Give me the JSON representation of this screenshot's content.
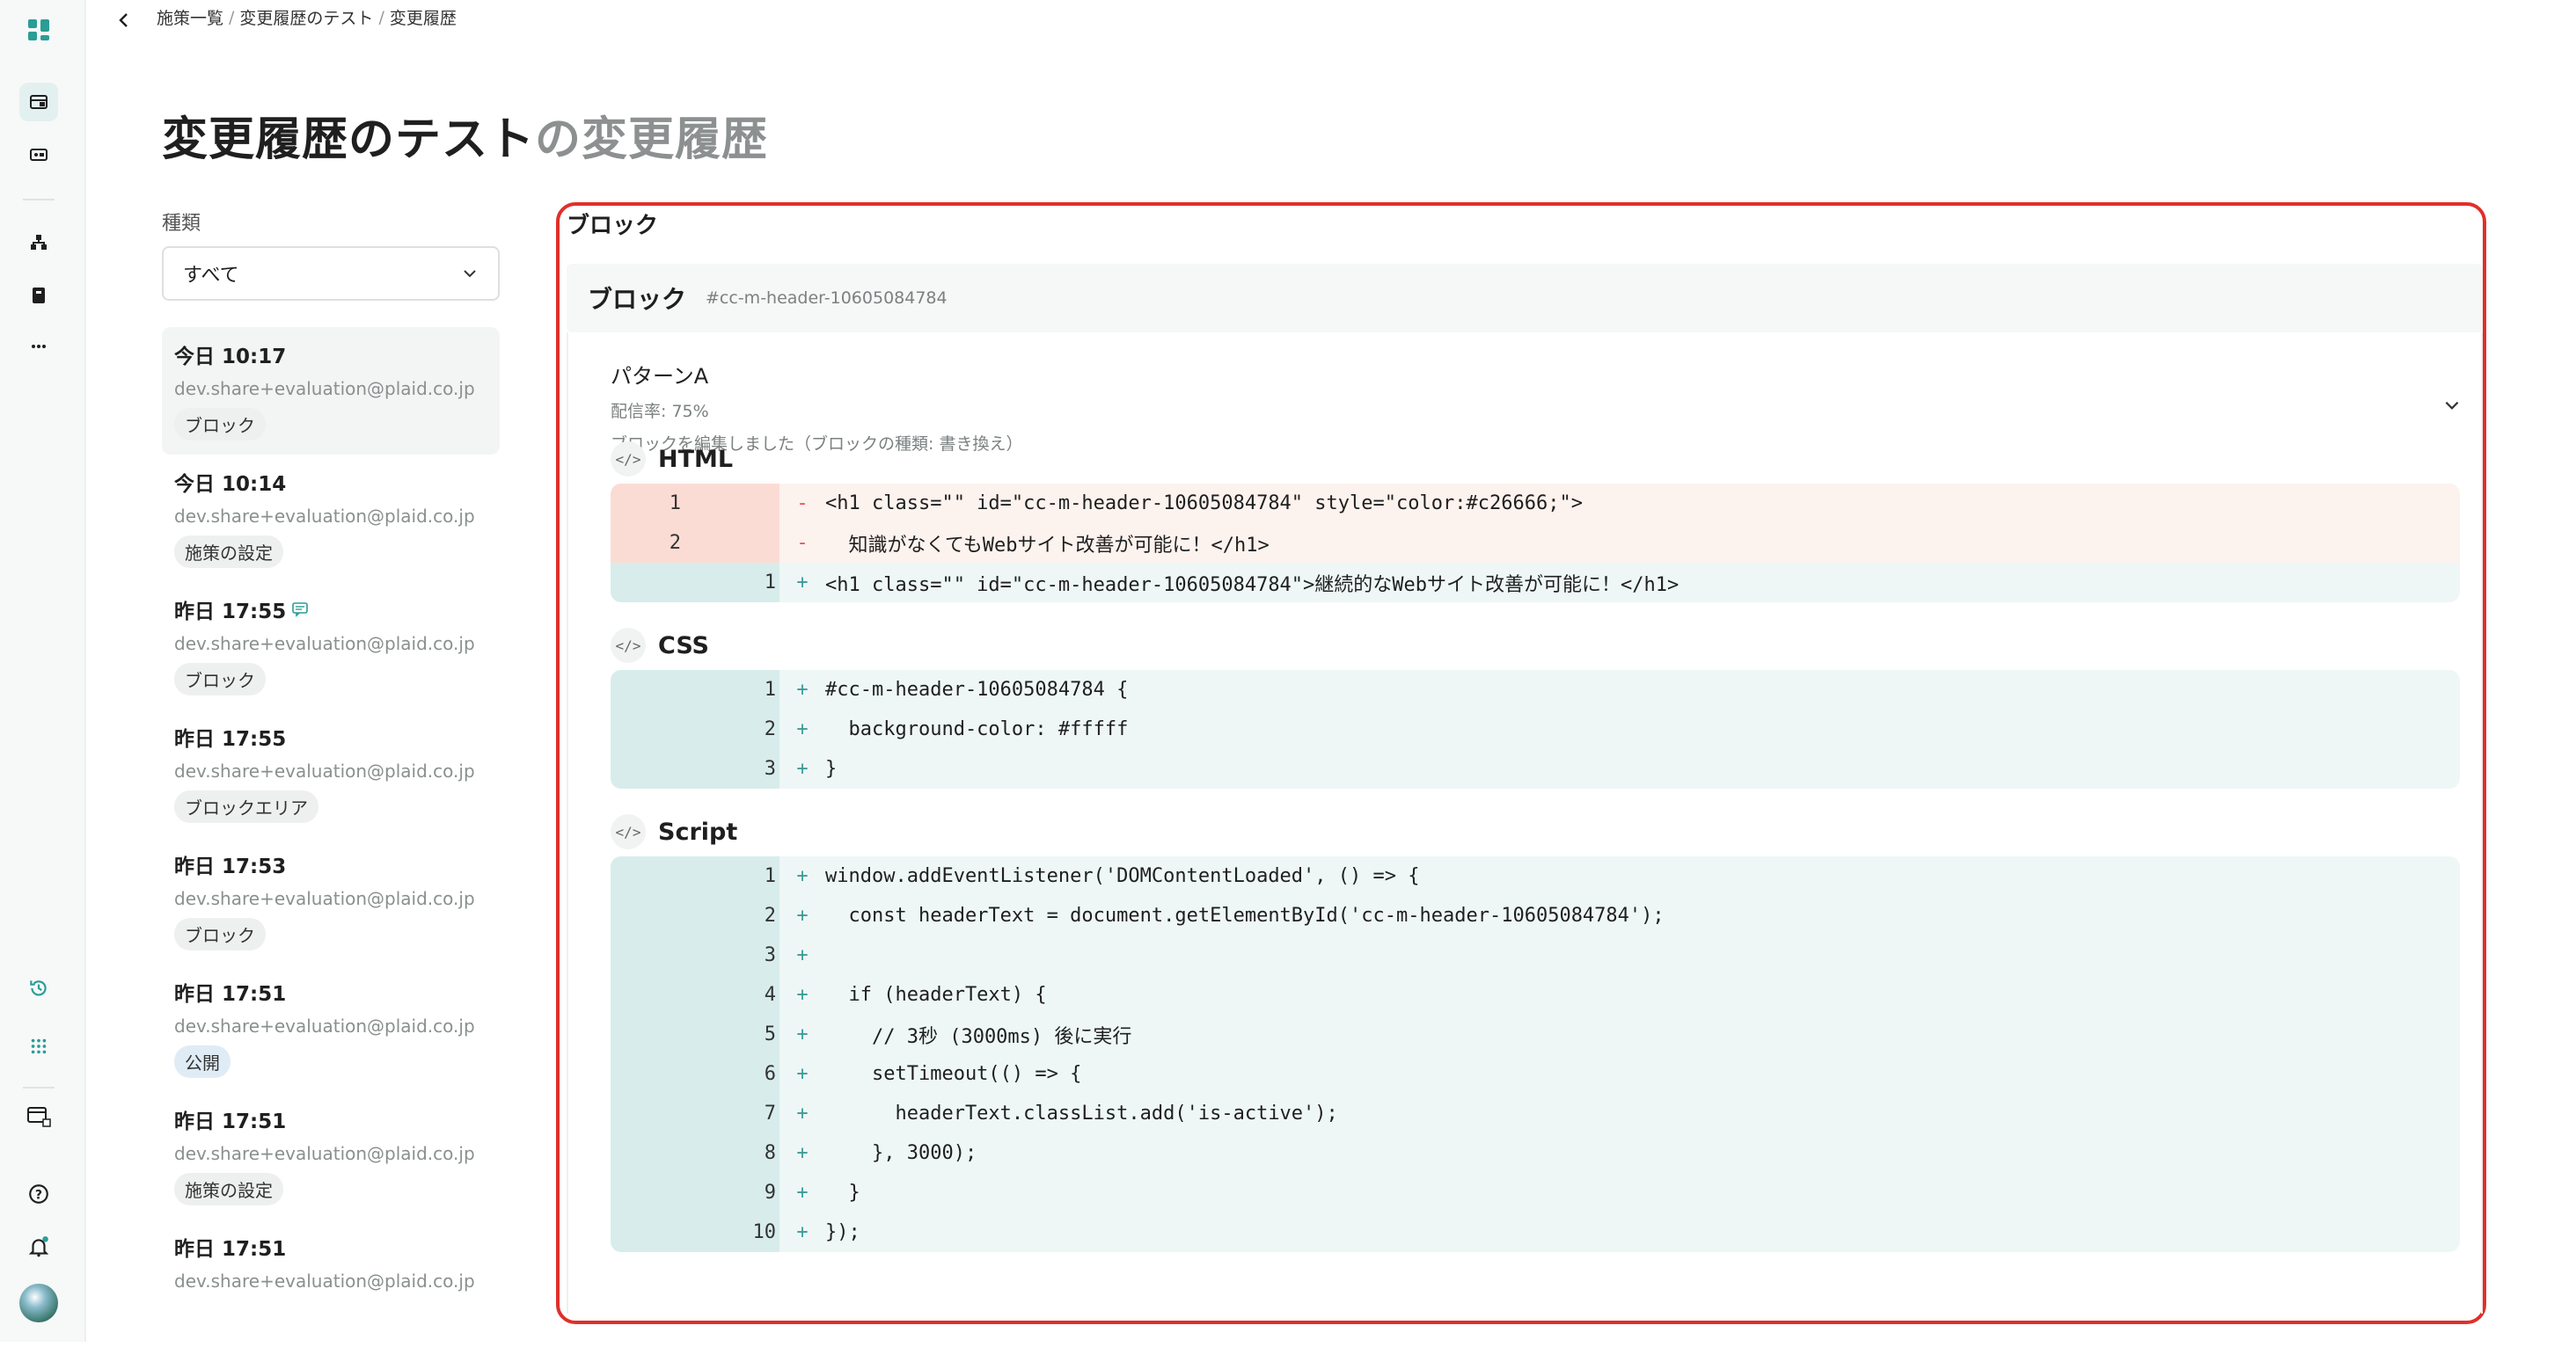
{
  "breadcrumb": [
    "施策一覧",
    "変更履歴のテスト",
    "変更履歴"
  ],
  "title": {
    "main": "変更履歴のテスト",
    "suffix": "の変更履歴"
  },
  "filter": {
    "label": "種類",
    "value": "すべて"
  },
  "history": [
    {
      "time": "今日 10:17",
      "email": "dev.share+evaluation@plaid.co.jp",
      "badge": "ブロック",
      "selected": true
    },
    {
      "time": "今日 10:14",
      "email": "dev.share+evaluation@plaid.co.jp",
      "badge": "施策の設定"
    },
    {
      "time": "昨日 17:55",
      "email": "dev.share+evaluation@plaid.co.jp",
      "badge": "ブロック",
      "comment": true
    },
    {
      "time": "昨日 17:55",
      "email": "dev.share+evaluation@plaid.co.jp",
      "badge": "ブロックエリア"
    },
    {
      "time": "昨日 17:53",
      "email": "dev.share+evaluation@plaid.co.jp",
      "badge": "ブロック"
    },
    {
      "time": "昨日 17:51",
      "email": "dev.share+evaluation@plaid.co.jp",
      "badge": "公開"
    },
    {
      "time": "昨日 17:51",
      "email": "dev.share+evaluation@plaid.co.jp",
      "badge": "施策の設定"
    },
    {
      "time": "昨日 17:51",
      "email": "dev.share+evaluation@plaid.co.jp",
      "badge": ""
    }
  ],
  "panel": {
    "title": "ブロック",
    "block_title": "ブロック",
    "block_id": "#cc-m-header-10605084784",
    "pattern_name": "パターンA",
    "pattern_rate": "配信率: 75%",
    "pattern_desc": "ブロックを編集しました（ブロックの種類: 書き換え）"
  },
  "sections": [
    {
      "name": "HTML",
      "lines": [
        {
          "old": "1",
          "new": "",
          "sign": "-",
          "type": "del",
          "text": "<h1 class=\"\" id=\"cc-m-header-10605084784\" style=\"color:#c26666;\">"
        },
        {
          "old": "2",
          "new": "",
          "sign": "-",
          "type": "del",
          "text": "  知識がなくてもWebサイト改善が可能に！</h1>"
        },
        {
          "old": "",
          "new": "1",
          "sign": "+",
          "type": "add",
          "text": "<h1 class=\"\" id=\"cc-m-header-10605084784\">継続的なWebサイト改善が可能に！</h1>"
        }
      ]
    },
    {
      "name": "CSS",
      "lines": [
        {
          "old": "",
          "new": "1",
          "sign": "+",
          "type": "add",
          "text": "#cc-m-header-10605084784 {"
        },
        {
          "old": "",
          "new": "2",
          "sign": "+",
          "type": "add",
          "text": "  background-color: #fffff"
        },
        {
          "old": "",
          "new": "3",
          "sign": "+",
          "type": "add",
          "text": "}"
        }
      ]
    },
    {
      "name": "Script",
      "lines": [
        {
          "old": "",
          "new": "1",
          "sign": "+",
          "type": "add",
          "text": "window.addEventListener('DOMContentLoaded', () => {"
        },
        {
          "old": "",
          "new": "2",
          "sign": "+",
          "type": "add",
          "text": "  const headerText = document.getElementById('cc-m-header-10605084784');"
        },
        {
          "old": "",
          "new": "3",
          "sign": "+",
          "type": "add",
          "text": ""
        },
        {
          "old": "",
          "new": "4",
          "sign": "+",
          "type": "add",
          "text": "  if (headerText) {"
        },
        {
          "old": "",
          "new": "5",
          "sign": "+",
          "type": "add",
          "text": "    // 3秒 (3000ms) 後に実行"
        },
        {
          "old": "",
          "new": "6",
          "sign": "+",
          "type": "add",
          "text": "    setTimeout(() => {"
        },
        {
          "old": "",
          "new": "7",
          "sign": "+",
          "type": "add",
          "text": "      headerText.classList.add('is-active');"
        },
        {
          "old": "",
          "new": "8",
          "sign": "+",
          "type": "add",
          "text": "    }, 3000);"
        },
        {
          "old": "",
          "new": "9",
          "sign": "+",
          "type": "add",
          "text": "  }"
        },
        {
          "old": "",
          "new": "10",
          "sign": "+",
          "type": "add",
          "text": "});"
        }
      ]
    }
  ],
  "colors": {
    "accent": "#2a9d96",
    "highlight_border": "#e0302a",
    "del_bg": "#fcf2ee",
    "add_bg": "#eef7f6"
  },
  "icons": [
    "app-logo-icon",
    "campaign-icon",
    "media-icon",
    "hierarchy-icon",
    "book-icon",
    "more-icon",
    "history-icon",
    "grid-icon",
    "window-icon",
    "help-icon",
    "bell-icon",
    "avatar"
  ]
}
